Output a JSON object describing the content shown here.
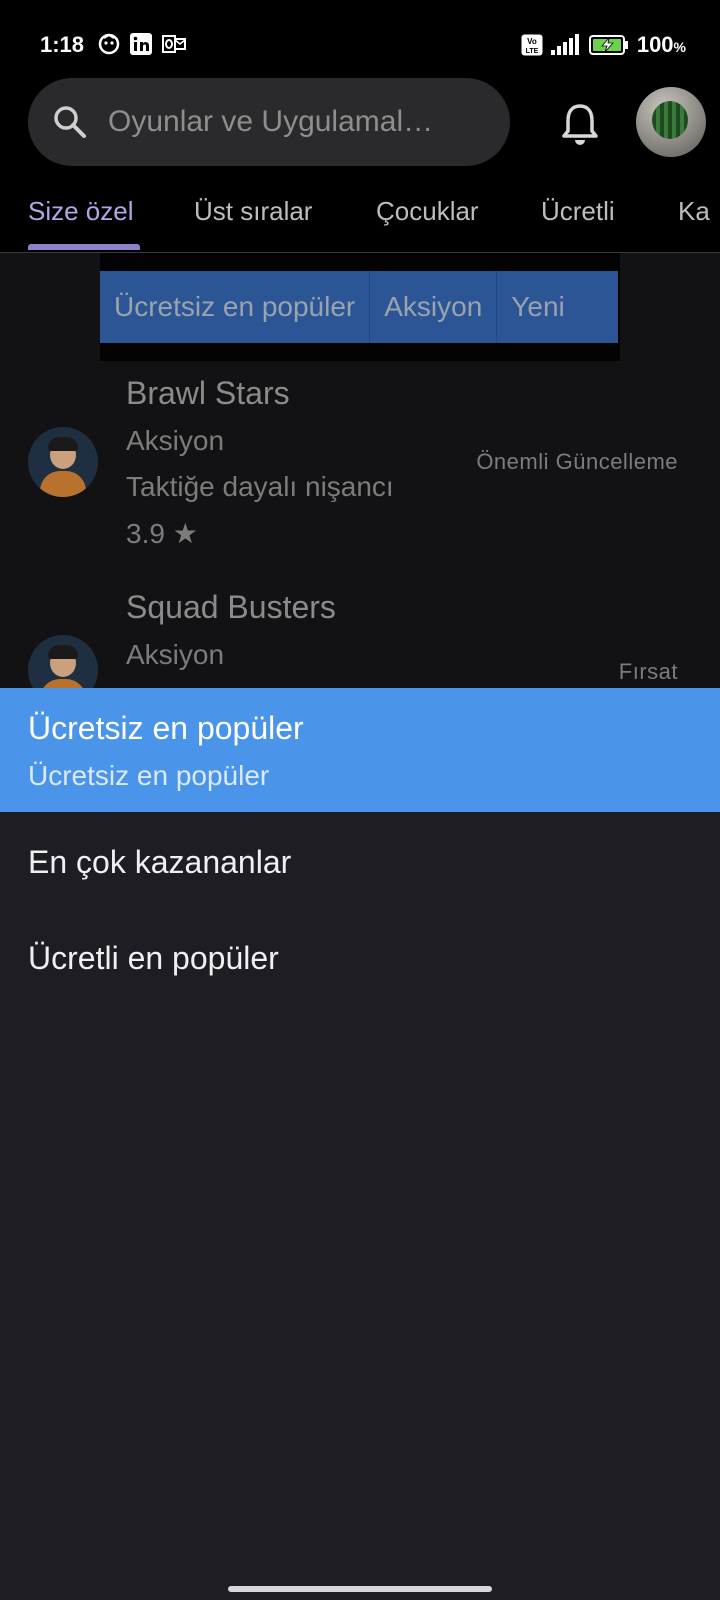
{
  "status_bar": {
    "time": "1:18",
    "battery_percent": "100",
    "battery_unit": "%",
    "network_label": "Vo LTE"
  },
  "search": {
    "placeholder": "Oyunlar ve Uygulamal…"
  },
  "tabs": [
    {
      "label": "Size özel",
      "active": true
    },
    {
      "label": "Üst sıralar",
      "active": false
    },
    {
      "label": "Çocuklar",
      "active": false
    },
    {
      "label": "Ücretli",
      "active": false
    },
    {
      "label": "Ka",
      "active": false
    }
  ],
  "chips": [
    {
      "label": "Ücretsiz en popüler"
    },
    {
      "label": "Aksiyon"
    },
    {
      "label": "Yeni"
    }
  ],
  "apps": [
    {
      "name": "Brawl Stars",
      "category": "Aksiyon",
      "description": "Taktiğe dayalı nişancı",
      "rating": "3.9 ★",
      "badge": "Önemli Güncelleme"
    },
    {
      "name": "Squad Busters",
      "category": "Aksiyon",
      "badge": "Fırsat"
    }
  ],
  "dropdown": {
    "selected": {
      "title": "Ücretsiz en popüler",
      "subtitle": "Ücretsiz en popüler"
    },
    "options": [
      {
        "label": "En çok kazananlar"
      },
      {
        "label": "Ücretli en popüler"
      }
    ]
  },
  "colors": {
    "accent_tab": "#b4a6e6",
    "selected_option": "#4a95ea",
    "sheet_background": "#1e1d23"
  }
}
